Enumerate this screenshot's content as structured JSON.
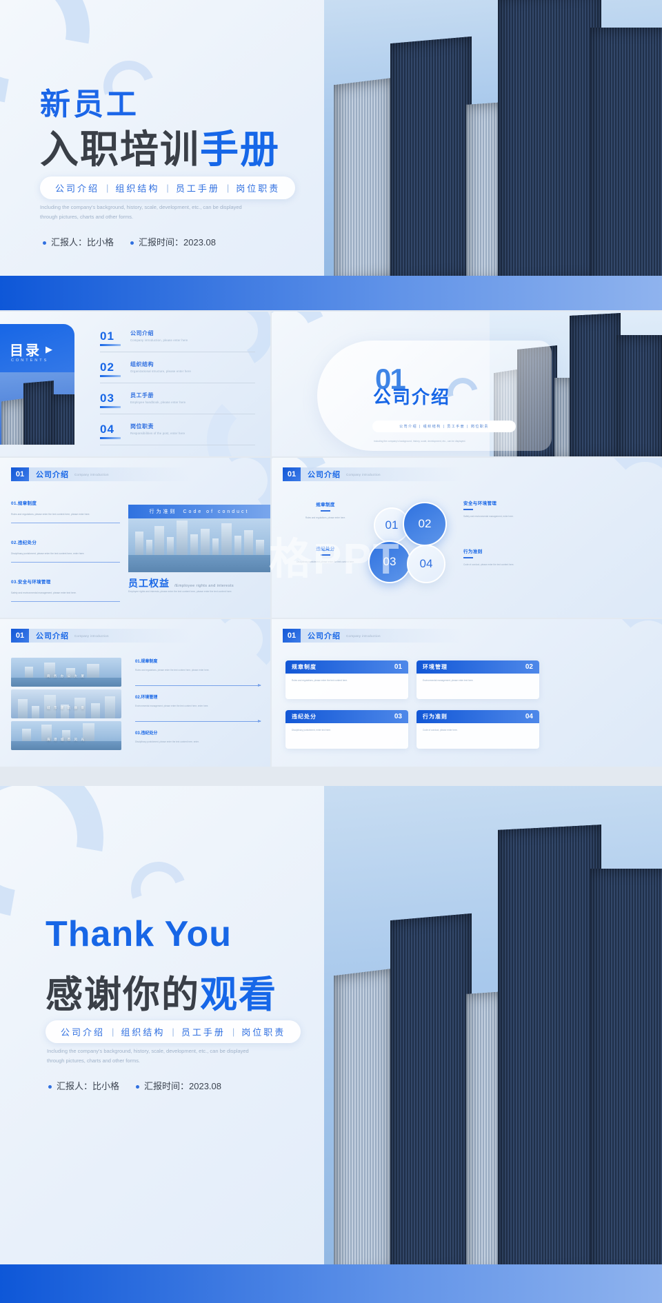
{
  "brand": {
    "primary": "#1766e6",
    "dark_text": "#3a3f47",
    "accent_light": "#5f92e8"
  },
  "cover": {
    "eyebrow": "新员工",
    "title_dark": "入职培训",
    "title_blue": "手册",
    "nav": [
      "公司介绍",
      "组织结构",
      "员工手册",
      "岗位职责"
    ],
    "separator": "|",
    "description": "Including the company's background, history, scale, development, etc., can be displayed through pictures, charts and other forms.",
    "reporter_label": "汇报人：比小格",
    "date_label": "汇报时间：2023.08"
  },
  "toc": {
    "title": "目录",
    "arrow_icon": "▶",
    "subtitle": "CONTENTS",
    "items": [
      {
        "num": "01",
        "cn": "公司介绍",
        "en": "Company introduction, please enter here"
      },
      {
        "num": "02",
        "cn": "组织结构",
        "en": "Organizational structure, please enter here"
      },
      {
        "num": "03",
        "cn": "员工手册",
        "en": "Employee handbook, please enter here"
      },
      {
        "num": "04",
        "cn": "岗位职责",
        "en": "Responsibilities of the post, enter here"
      }
    ]
  },
  "divider": {
    "number": "01",
    "cn": "公司介绍",
    "pill": "公司介绍 | 组织结构 | 员工手册 | 岗位职责",
    "description": "Including the company's background, history, scale, development, etc., can be displayed."
  },
  "section_header": {
    "num": "01",
    "cn": "公司介绍",
    "en": "Company introduction"
  },
  "slide_rules": {
    "list": [
      {
        "h": "01.规章制度",
        "p": "Rules and regulations, please enter the text content here, please enter here."
      },
      {
        "h": "02.违纪处分",
        "p": "Disciplinary punishment, please enter the text content here, enter here."
      },
      {
        "h": "03.安全与环境管理",
        "p": "Safety and environmental management, please enter text here."
      }
    ],
    "band_cn": "行为准则",
    "band_en": "Code of conduct",
    "benefit_cn": "员工权益",
    "benefit_en": "/Employee rights and interests",
    "benefit_p": "Employee rights and interests, please enter the text content here, please enter the text content here."
  },
  "slide_bubbles": {
    "bubbles": [
      "01",
      "02",
      "03",
      "04"
    ],
    "labels": [
      {
        "h": "规章制度",
        "p": "Rules and regulations, please enter here."
      },
      {
        "h": "安全与环境管理",
        "p": "Safety and environmental management, enter here."
      },
      {
        "h": "违纪处分",
        "p": "Disciplinary punishment, please enter the text content here."
      },
      {
        "h": "行为准则",
        "p": "Code of conduct, please enter the text content here."
      }
    ]
  },
  "slide_images": {
    "strips": [
      "商 务 办 公 大 厦",
      "城 市 建 筑 群 景",
      "海 港 城 市 风 光"
    ],
    "items": [
      {
        "h": "01.规章制度",
        "p": "Rules and regulations, please enter the text content here, please enter here."
      },
      {
        "h": "02.环境管理",
        "p": "Environmental management, please enter the text content here, enter here."
      },
      {
        "h": "03.违纪处分",
        "p": "Disciplinary punishment, please enter the text content here, enter."
      }
    ]
  },
  "slide_cards": {
    "cards": [
      {
        "t": "规章制度",
        "n": "01",
        "p": "Rules and regulations, please enter the text content here."
      },
      {
        "t": "环境管理",
        "n": "02",
        "p": "Environmental management, please enter text here."
      },
      {
        "t": "违纪处分",
        "n": "03",
        "p": "Disciplinary punishment, enter text here."
      },
      {
        "t": "行为准则",
        "n": "04",
        "p": "Code of conduct, please enter here."
      }
    ]
  },
  "thanks": {
    "en_title": "Thank You",
    "cn_dark": "感谢你的",
    "cn_blue": "观看",
    "nav": [
      "公司介绍",
      "组织结构",
      "员工手册",
      "岗位职责"
    ],
    "separator": "|",
    "description": "Including the company's background, history, scale, development, etc., can be displayed through pictures, charts and other forms.",
    "reporter_label": "汇报人：比小格",
    "date_label": "汇报时间：2023.08"
  },
  "watermark": "格PPT"
}
